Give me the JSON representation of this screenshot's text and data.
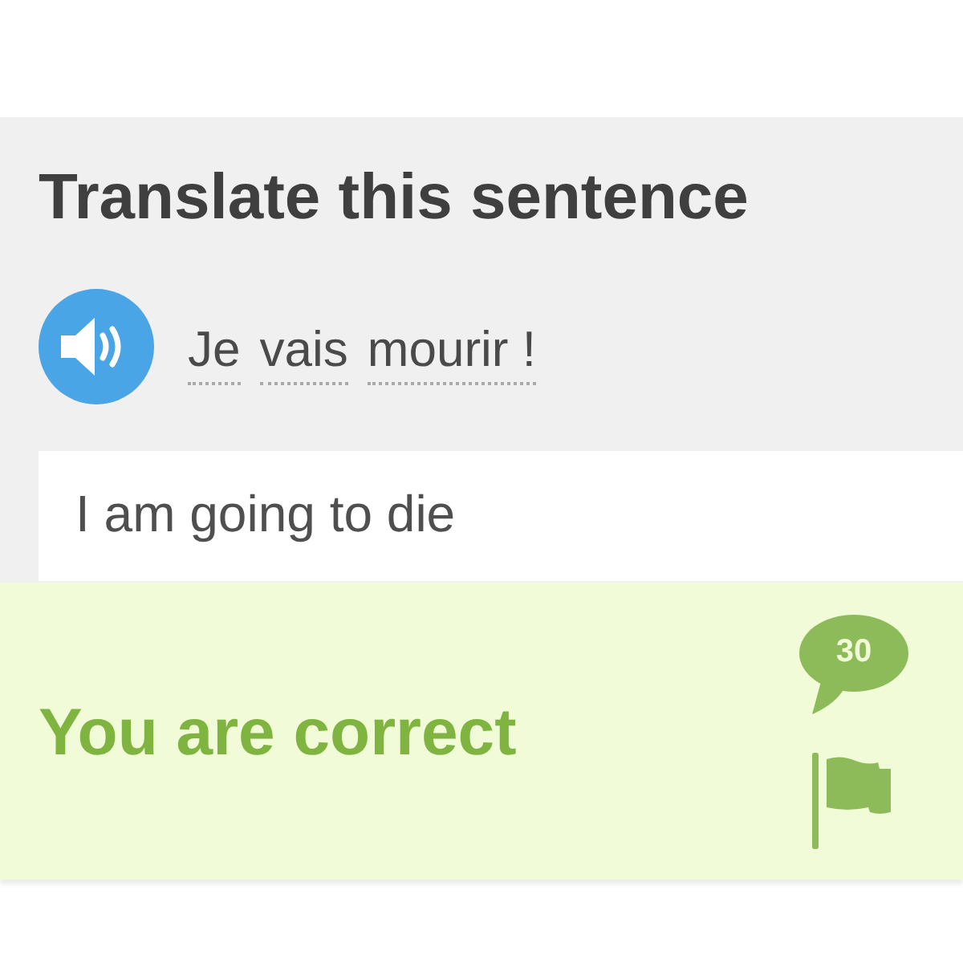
{
  "exercise": {
    "title": "Translate this sentence",
    "prompt_words": [
      "Je",
      "vais",
      "mourir !"
    ],
    "answer": {
      "value": "I am going to die"
    }
  },
  "feedback": {
    "kind": "correct",
    "message": "You are correct",
    "comment_count": "30"
  }
}
